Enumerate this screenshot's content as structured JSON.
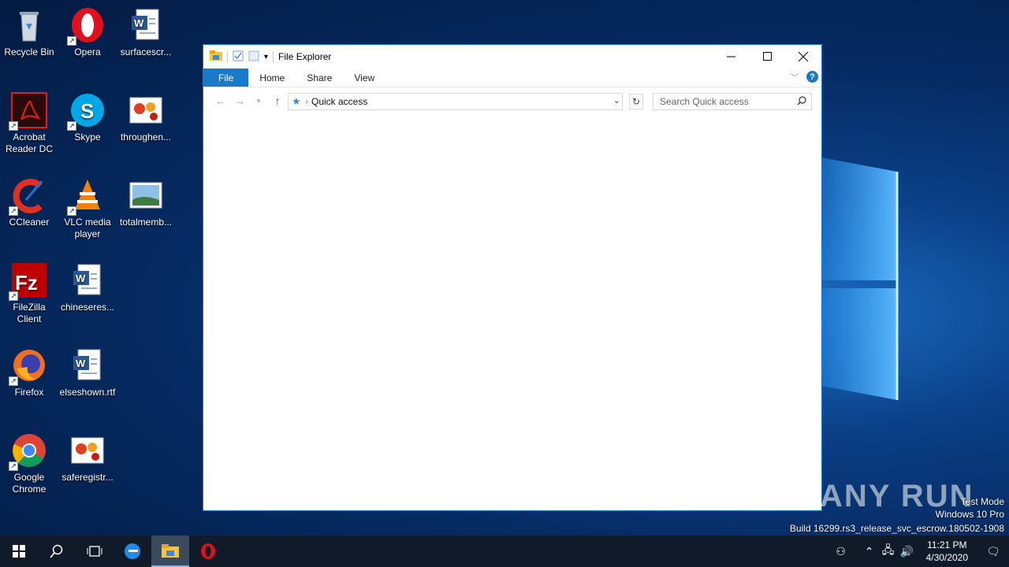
{
  "desktop": {
    "icons": [
      {
        "label": "Recycle Bin"
      },
      {
        "label": "Opera"
      },
      {
        "label": "surfacescr..."
      },
      {
        "label": "Acrobat Reader DC"
      },
      {
        "label": "Skype"
      },
      {
        "label": "throughen..."
      },
      {
        "label": "CCleaner"
      },
      {
        "label": "VLC media player"
      },
      {
        "label": "totalmemb..."
      },
      {
        "label": "FileZilla Client"
      },
      {
        "label": "chineseres..."
      },
      {
        "label": "Firefox"
      },
      {
        "label": "elseshown.rtf"
      },
      {
        "label": "Google Chrome"
      },
      {
        "label": "saferegistr..."
      }
    ]
  },
  "window": {
    "title": "File Explorer",
    "ribbon_tabs": [
      "File",
      "Home",
      "Share",
      "View"
    ],
    "address": "Quick access",
    "search_placeholder": "Search Quick access"
  },
  "watermark": {
    "line1": "Test Mode",
    "line2": "Windows 10 Pro",
    "line3": "Build 16299.rs3_release_svc_escrow.180502-1908",
    "brand": "ANY RUN"
  },
  "taskbar": {
    "time": "11:21 PM",
    "date": "4/30/2020"
  },
  "colors": {
    "accent": "#1979ca",
    "taskbar": "#101a28"
  }
}
